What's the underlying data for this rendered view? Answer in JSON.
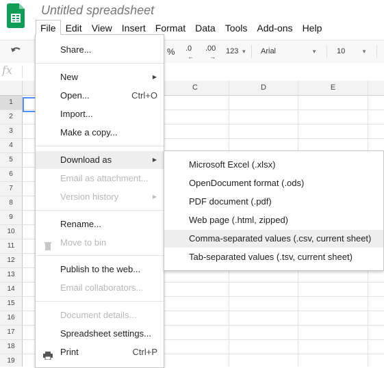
{
  "document": {
    "title": "Untitled spreadsheet"
  },
  "menubar": {
    "items": [
      "File",
      "Edit",
      "View",
      "Insert",
      "Format",
      "Data",
      "Tools",
      "Add-ons",
      "Help"
    ],
    "active": "File"
  },
  "toolbar": {
    "percent": "%",
    "decrease_decimal": ".0",
    "increase_decimal": ".00",
    "more_formats": "123",
    "font": "Arial",
    "font_size": "10"
  },
  "formula_bar": {
    "label": "fx"
  },
  "grid": {
    "visible_column_headers": [
      "C",
      "D",
      "E"
    ],
    "row_numbers": [
      "1",
      "2",
      "3",
      "4",
      "5",
      "6",
      "7",
      "8",
      "9",
      "10",
      "11",
      "12",
      "13",
      "14",
      "15",
      "16",
      "17",
      "18",
      "19"
    ],
    "selected_cell": "A1"
  },
  "file_menu": {
    "items": [
      {
        "label": "Share...",
        "shortcut": "",
        "disabled": false
      },
      {
        "label": "New",
        "shortcut": "",
        "disabled": false,
        "submenu": true
      },
      {
        "label": "Open...",
        "shortcut": "Ctrl+O",
        "disabled": false
      },
      {
        "label": "Import...",
        "shortcut": "",
        "disabled": false
      },
      {
        "label": "Make a copy...",
        "shortcut": "",
        "disabled": false
      },
      {
        "label": "Download as",
        "shortcut": "",
        "disabled": false,
        "submenu": true,
        "highlighted": true
      },
      {
        "label": "Email as attachment...",
        "shortcut": "",
        "disabled": true
      },
      {
        "label": "Version history",
        "shortcut": "",
        "disabled": true,
        "submenu": true
      },
      {
        "label": "Rename...",
        "shortcut": "",
        "disabled": false
      },
      {
        "label": "Move to bin",
        "shortcut": "",
        "disabled": true,
        "icon": "trash-icon"
      },
      {
        "label": "Publish to the web...",
        "shortcut": "",
        "disabled": false
      },
      {
        "label": "Email collaborators...",
        "shortcut": "",
        "disabled": true
      },
      {
        "label": "Document details...",
        "shortcut": "",
        "disabled": true
      },
      {
        "label": "Spreadsheet settings...",
        "shortcut": "",
        "disabled": false
      },
      {
        "label": "Print",
        "shortcut": "Ctrl+P",
        "disabled": false,
        "icon": "printer-icon"
      }
    ]
  },
  "download_submenu": {
    "items": [
      {
        "label": "Microsoft Excel (.xlsx)"
      },
      {
        "label": "OpenDocument format (.ods)"
      },
      {
        "label": "PDF document (.pdf)"
      },
      {
        "label": "Web page (.html, zipped)"
      },
      {
        "label": "Comma-separated values (.csv, current sheet)",
        "highlighted": true
      },
      {
        "label": "Tab-separated values (.tsv, current sheet)"
      }
    ]
  },
  "colors": {
    "logo_green": "#0f9d58",
    "selection_blue": "#4d90fe",
    "menu_highlight": "#eeeeee",
    "disabled_text": "#b8b8b8"
  }
}
